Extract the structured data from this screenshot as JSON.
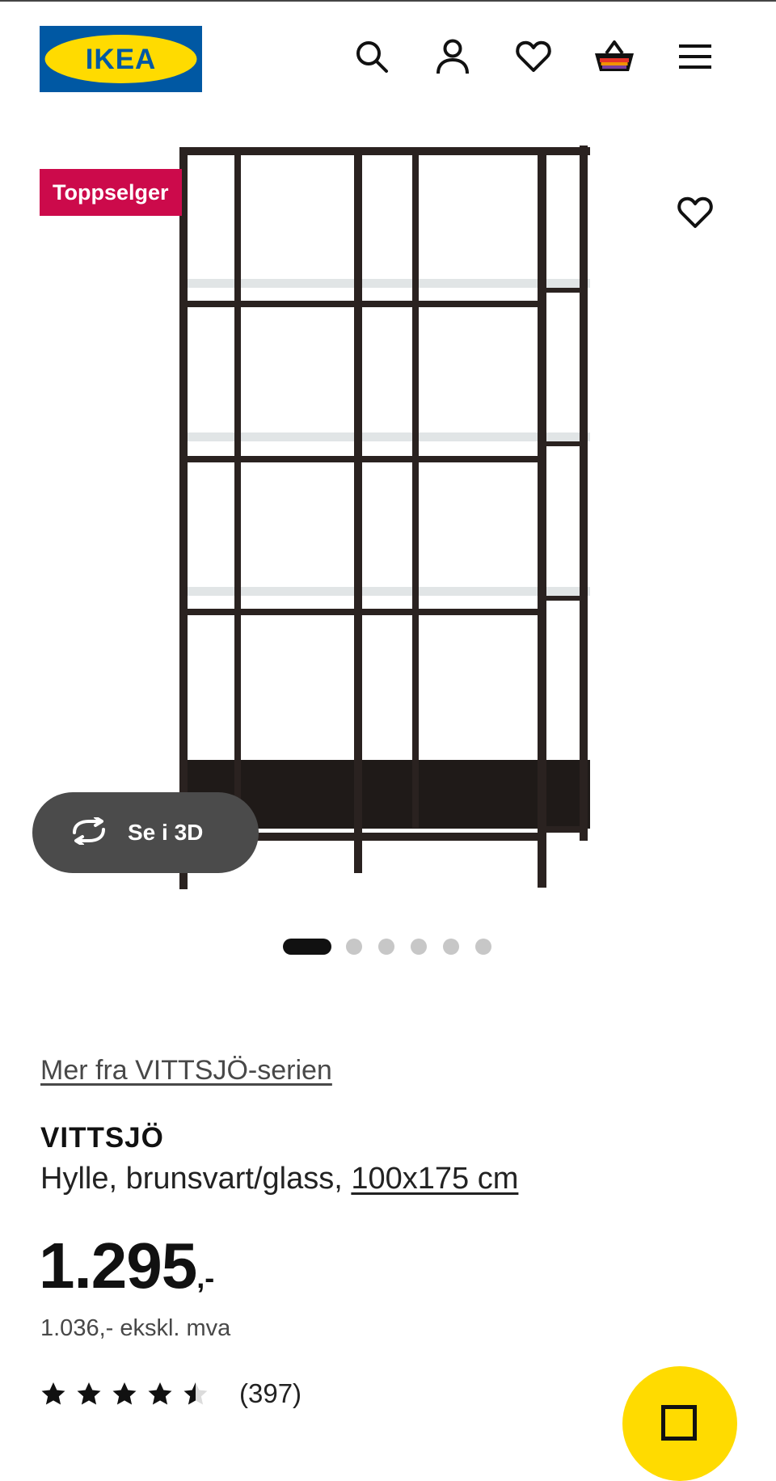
{
  "header": {
    "logo_text": "IKEA",
    "icons": [
      "search-icon",
      "account-icon",
      "heart-icon",
      "basket-icon",
      "menu-icon"
    ]
  },
  "gallery": {
    "badge": "Toppselger",
    "view_3d_label": "Se i 3D",
    "slides_total": 6,
    "active_slide": 1
  },
  "product": {
    "series_link": "Mer fra VITTSJÖ-serien",
    "name": "VITTSJÖ",
    "description": "Hylle, brunsvart/glass,",
    "size": "100x175 cm",
    "price_main": "1.295",
    "price_suffix": ",-",
    "price_ex_vat": "1.036,- ekskl. mva",
    "rating_value": 4.5,
    "rating_count": "(397)"
  },
  "colors": {
    "logo_blue": "#0058a3",
    "logo_yellow": "#ffdb00",
    "badge_red": "#cc0a4b",
    "fab_yellow": "#ffdb00"
  }
}
